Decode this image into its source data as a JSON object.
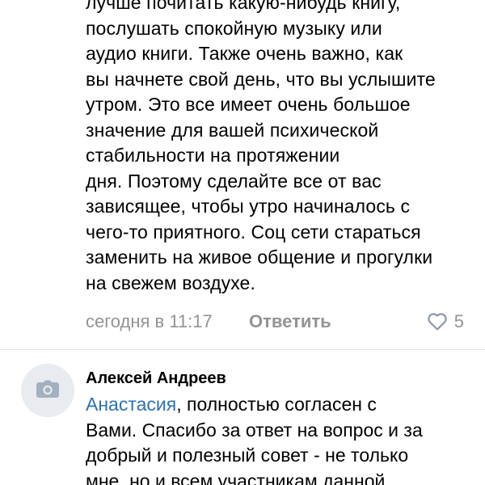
{
  "comment": {
    "lines": [
      "лучше почитать какую-нибудь книгу,",
      "послушать спокойную  музыку или",
      "аудио книги. Также очень важно, как",
      "вы начнете свой день, что вы услышите",
      "утром. Это все имеет очень большое",
      "значение для вашей психической",
      "стабильности на протяжении",
      "дня. Поэтому сделайте все от вас",
      "зависящее, чтобы утро начиналось с",
      "чего-то приятного. Соц сети стараться",
      "заменить на живое общение и прогулки",
      "на свежем воздухе."
    ],
    "timestamp": "сегодня в 11:17",
    "reply_label": "Ответить",
    "like_count": "5"
  },
  "reply": {
    "author": "Алексей Андреев",
    "mention": "Анастасия",
    "first_line_rest": ", полностью согласен с",
    "lines": [
      "Вами. Спасибо за ответ на вопрос и за",
      "добрый и полезный совет - не только",
      "мне, но и всем участникам данной"
    ]
  },
  "icons": {
    "like": "heart-outline-icon",
    "avatar_placeholder": "camera-icon"
  },
  "colors": {
    "meta_text": "#939393",
    "mention_link": "#2a72b5",
    "icon_gray": "#8e9aa8",
    "avatar_bg": "#e8ecf1",
    "divider": "#e3e4e8"
  }
}
